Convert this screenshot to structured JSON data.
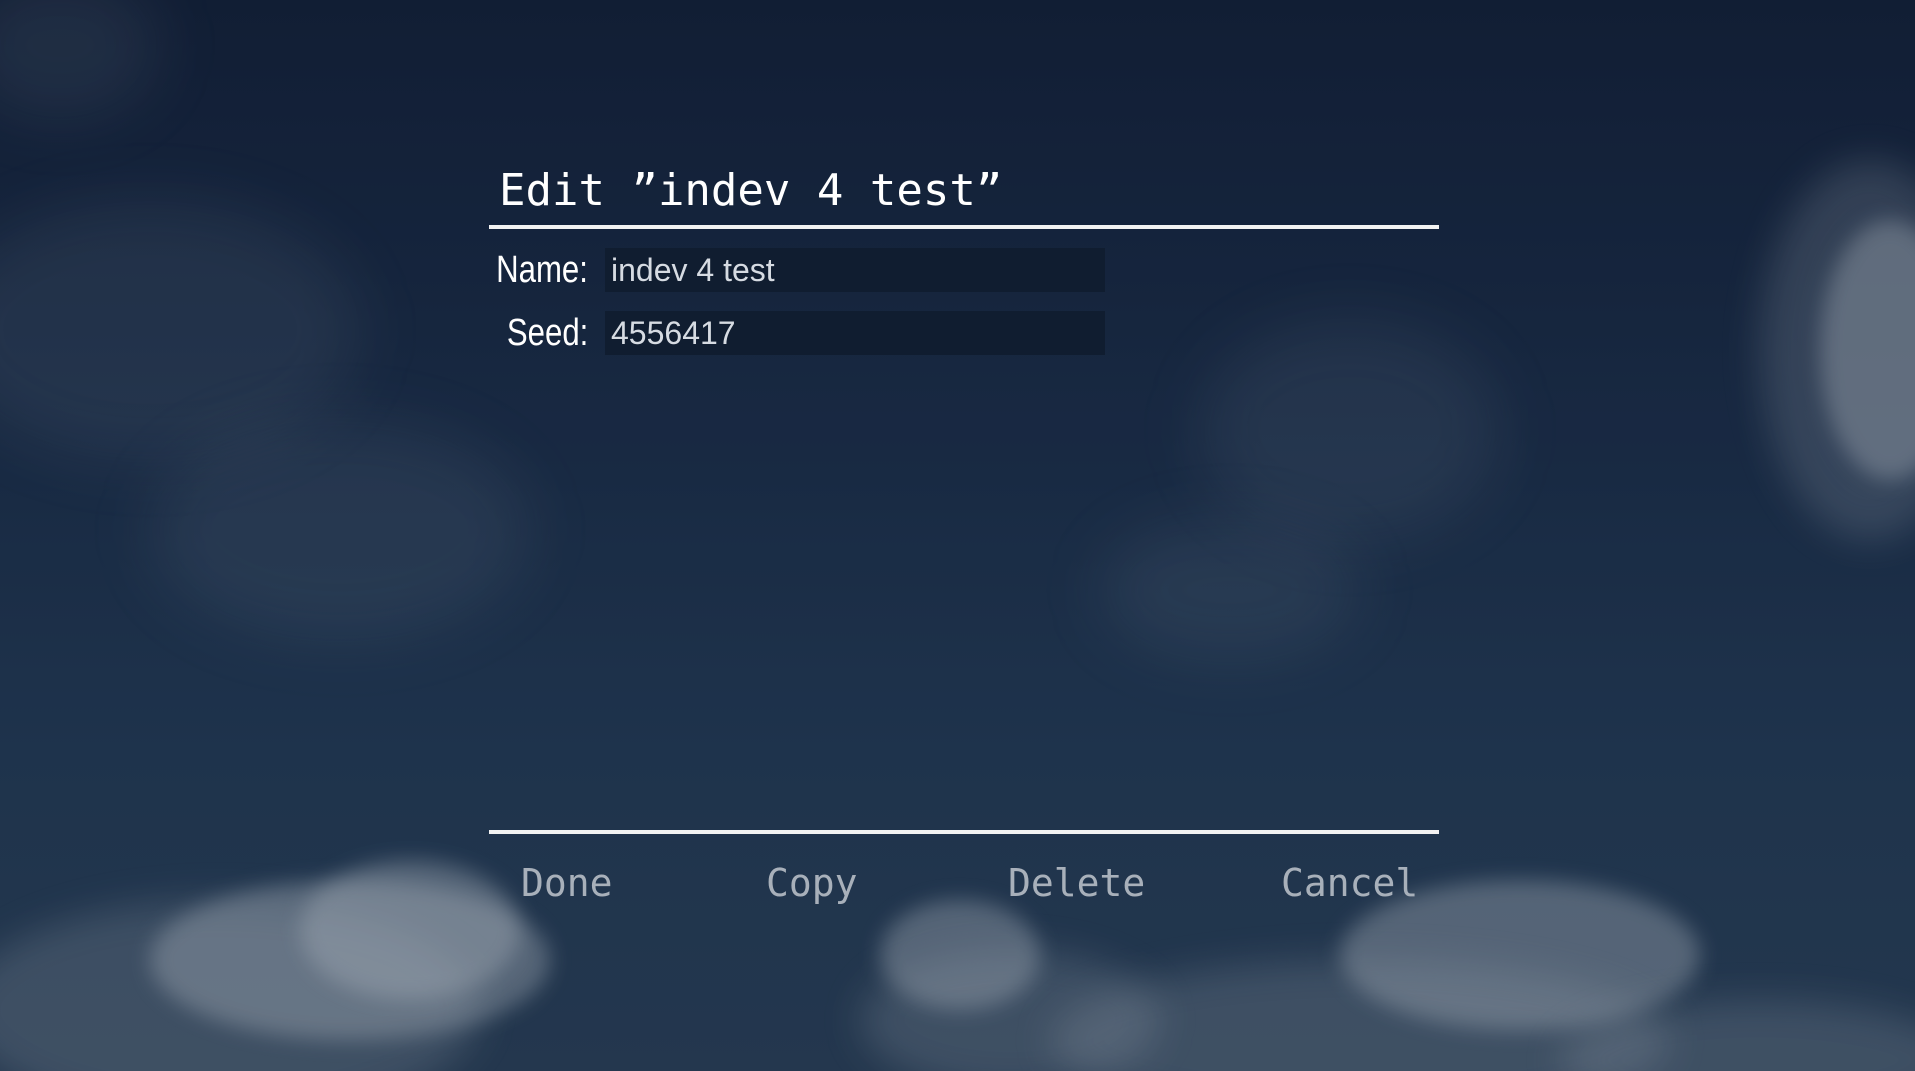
{
  "dialog": {
    "title": "Edit ”indev 4 test”"
  },
  "fields": {
    "name": {
      "label": "Name:",
      "value": "indev 4 test"
    },
    "seed": {
      "label": "Seed:",
      "value": "4556417"
    }
  },
  "buttons": {
    "done": "Done",
    "copy": "Copy",
    "delete": "Delete",
    "cancel": "Cancel"
  },
  "colors": {
    "background": "#1b2d48",
    "text": "#ffffff",
    "button_text": "#a8b0ba",
    "input_bg": "#0f1c2e",
    "rule": "#f2f2f2"
  }
}
